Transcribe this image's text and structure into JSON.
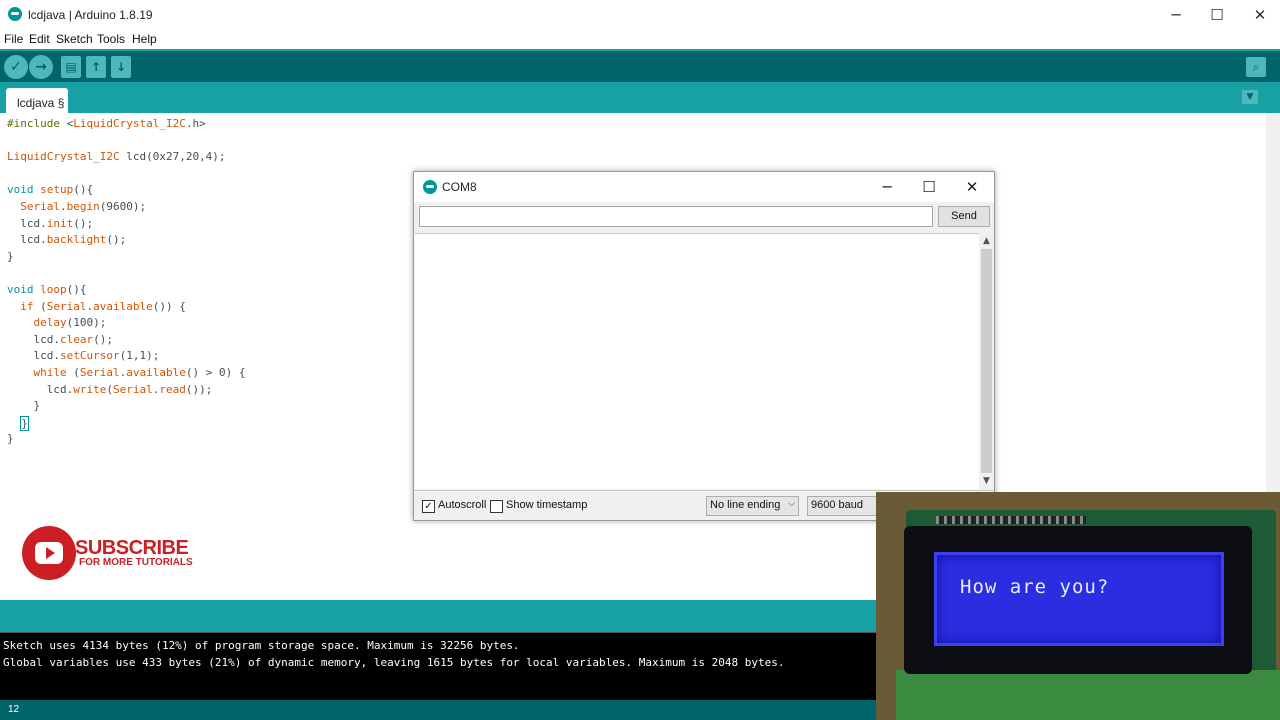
{
  "window": {
    "title": "lcdjava | Arduino 1.8.19"
  },
  "menu": [
    "File",
    "Edit",
    "Sketch",
    "Tools",
    "Help"
  ],
  "toolbar": {
    "buttons": [
      "verify-icon",
      "upload-icon",
      "new-icon",
      "open-icon",
      "save-icon",
      "serial-monitor-icon"
    ]
  },
  "tabs": [
    {
      "label": "lcdjava §"
    }
  ],
  "code": [
    "#include <LiquidCrystal_I2C.h>",
    "",
    "LiquidCrystal_I2C lcd(0x27,20,4);",
    "",
    "void setup(){",
    "  Serial.begin(9600);",
    "  lcd.init();",
    "  lcd.backlight();",
    "}",
    "",
    "void loop(){",
    "  if (Serial.available()) {",
    "    delay(100);",
    "    lcd.clear();",
    "    lcd.setCursor(1,1);",
    "    while (Serial.available() > 0) {",
    "      lcd.write(Serial.read());",
    "    }",
    "  }",
    "}"
  ],
  "promo": {
    "main": "SUBSCRIBE",
    "sub": "FOR MORE TUTORIALS"
  },
  "console": {
    "lines": [
      "Sketch uses 4134 bytes (12%) of program storage space. Maximum is 32256 bytes.",
      "Global variables use 433 bytes (21%) of dynamic memory, leaving 1615 bytes for local variables. Maximum is 2048 bytes."
    ]
  },
  "statusbar": {
    "line_number": "12"
  },
  "serial_monitor": {
    "title": "COM8",
    "input_value": "",
    "send_label": "Send",
    "output": "",
    "autoscroll_label": "Autoscroll",
    "autoscroll_checked": true,
    "timestamp_label": "Show timestamp",
    "timestamp_checked": false,
    "line_ending": "No line ending",
    "baud": "9600 baud"
  },
  "lcd_photo": {
    "display_text": "How are you?"
  },
  "colors": {
    "arduino_teal_dark": "#006468",
    "arduino_teal": "#17a1a5",
    "keyword_orange": "#d35400",
    "subscribe_red": "#cc1f25",
    "lcd_blue": "#2a2ee0"
  }
}
